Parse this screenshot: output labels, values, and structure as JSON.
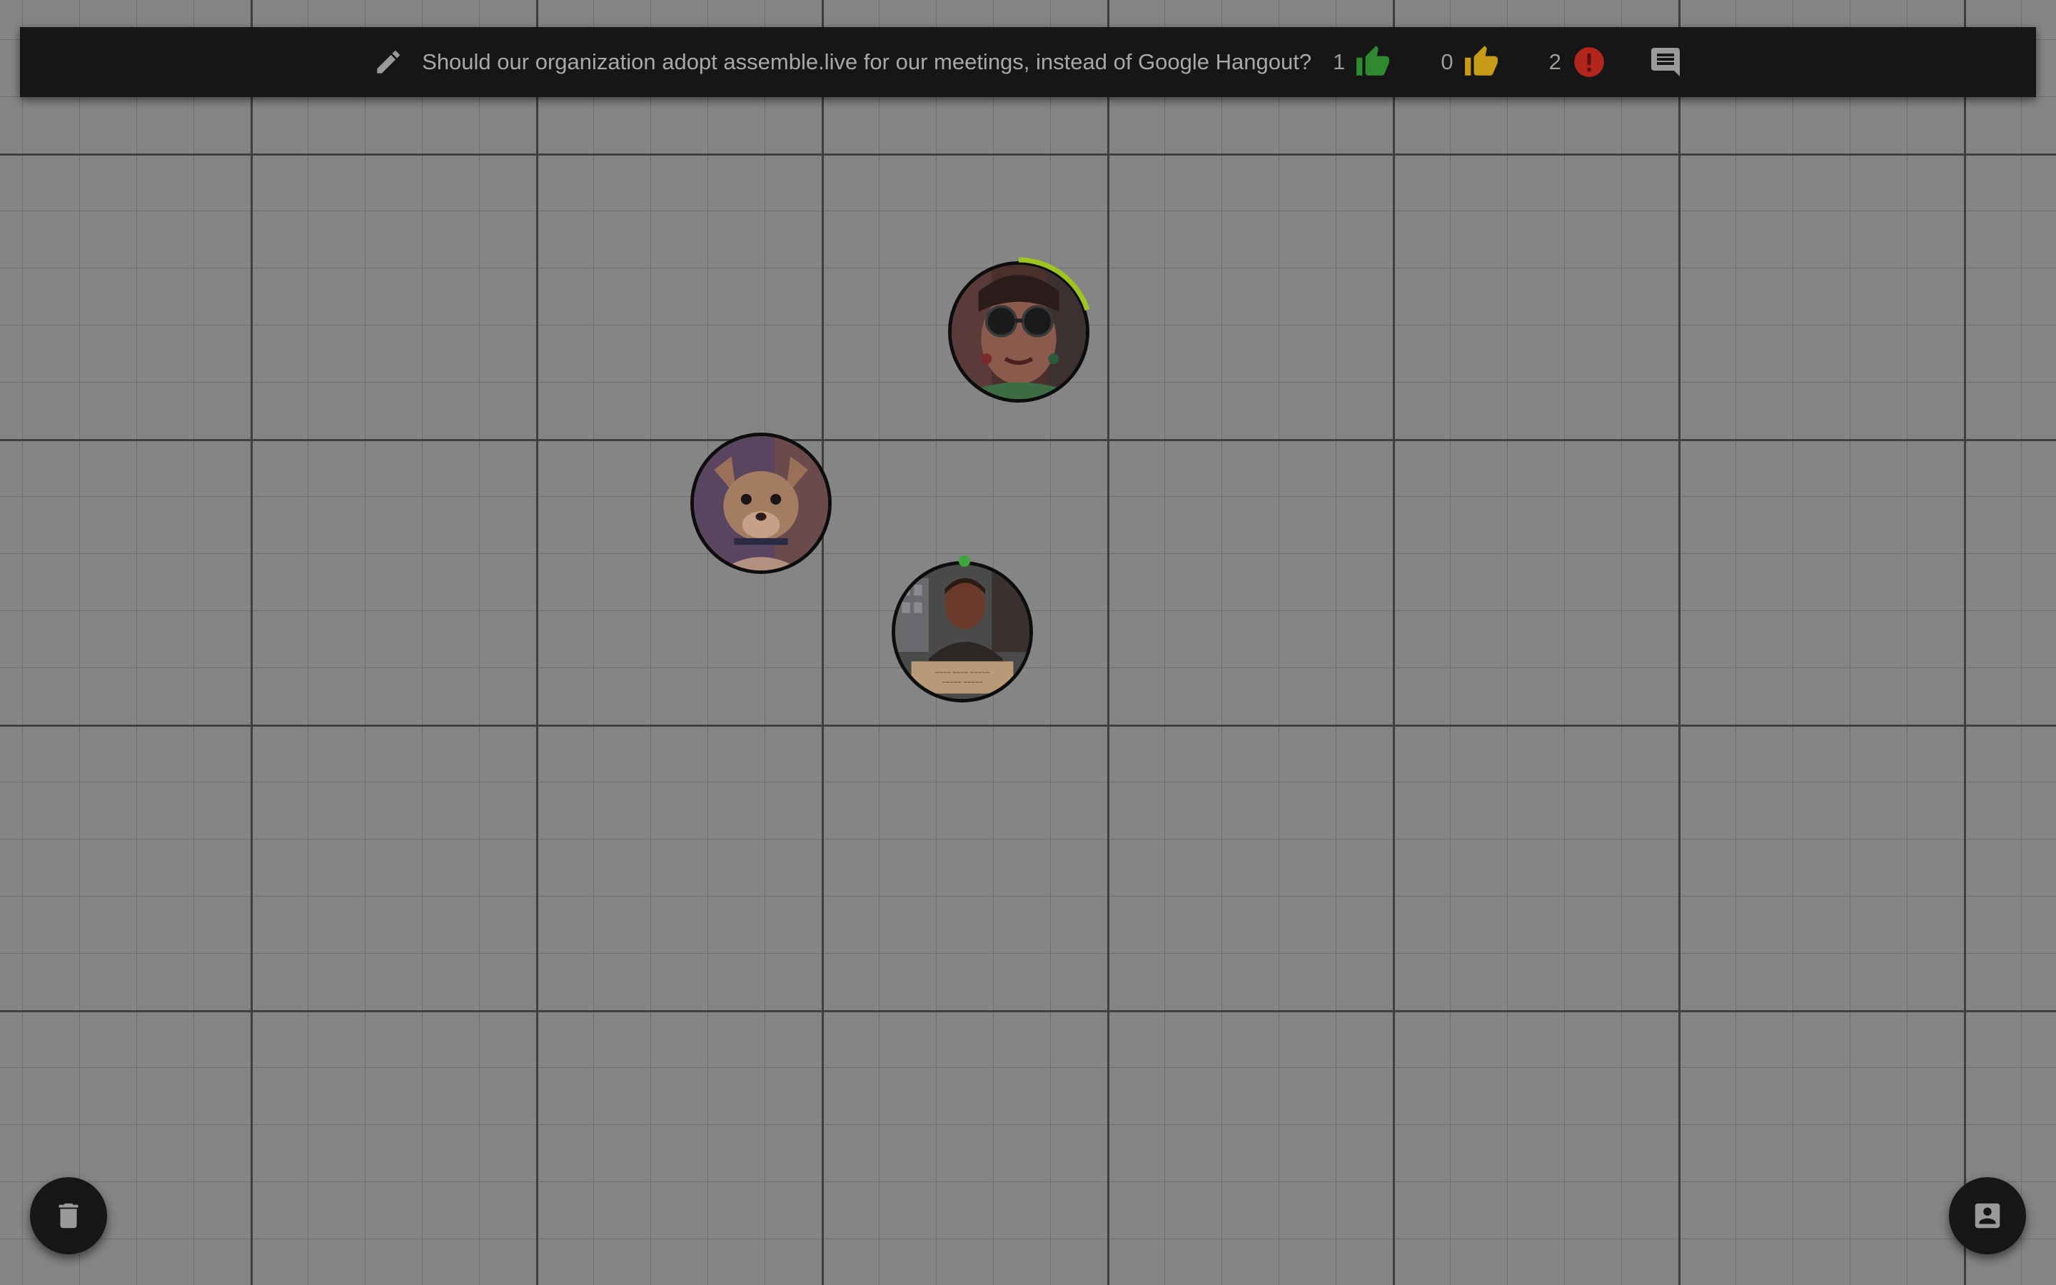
{
  "topbar": {
    "question": "Should our organization adopt assemble.live for our meetings, instead of Google Hangout?",
    "votes": [
      {
        "count": "1",
        "icon": "thumbs-up-green-icon",
        "color": "#2f8a2f"
      },
      {
        "count": "0",
        "icon": "thumbs-up-yellow-icon",
        "color": "#c79a18"
      },
      {
        "count": "2",
        "icon": "alert-red-icon",
        "color": "#b3261e"
      }
    ],
    "edit_icon": "pencil-icon",
    "comments_icon": "comment-icon"
  },
  "participants": [
    {
      "name": "woman-with-sunglasses",
      "speaking": true,
      "speaking_level": 0.3,
      "ring_color": "#9dc41f"
    },
    {
      "name": "chihuahua-dog",
      "speaking": false
    },
    {
      "name": "man-with-sign",
      "speaking": false,
      "status": "online",
      "status_color": "#3aa83a"
    }
  ],
  "actions": {
    "trash_icon": "trash-icon",
    "contact_icon": "contact-card-icon"
  }
}
